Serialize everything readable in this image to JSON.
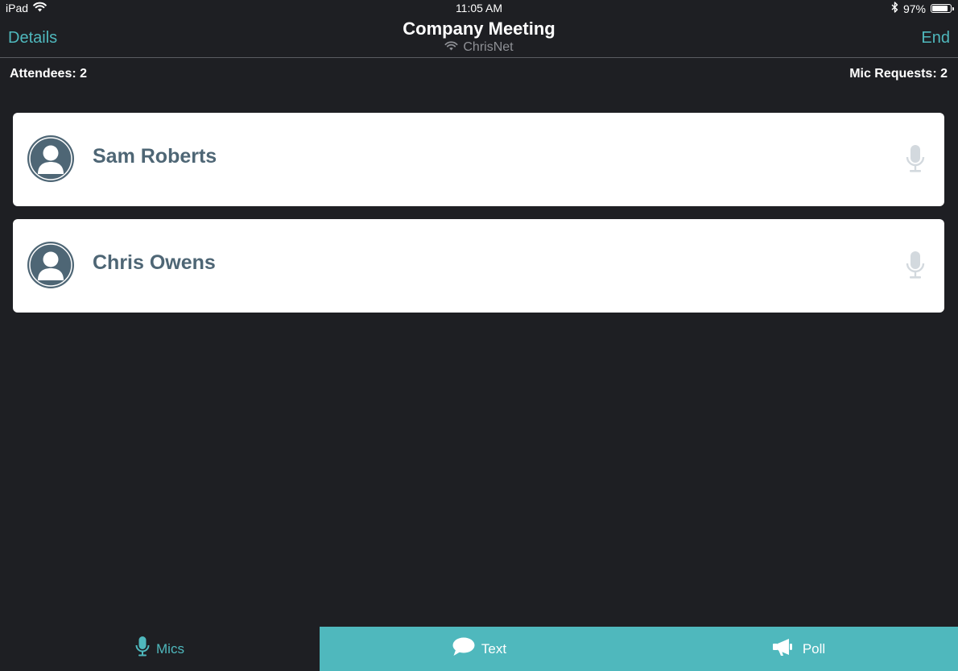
{
  "status_bar": {
    "device": "iPad",
    "time": "11:05 AM",
    "battery_text": "97%",
    "battery_level": 0.97,
    "wifi_icon": "wifi-icon",
    "bluetooth_icon": "bluetooth-icon"
  },
  "nav": {
    "left_label": "Details",
    "title": "Company Meeting",
    "network_name": "ChrisNet",
    "right_label": "End"
  },
  "counters": {
    "attendees": "Attendees: 2",
    "mic_requests": "Mic Requests: 2"
  },
  "attendees": [
    {
      "name": "Sam Roberts",
      "avatar_icon": "person-icon",
      "mic_icon": "microphone-icon"
    },
    {
      "name": "Chris Owens",
      "avatar_icon": "person-icon",
      "mic_icon": "microphone-icon"
    }
  ],
  "tabs": [
    {
      "label": "Mics",
      "icon": "microphone-icon",
      "selected": true
    },
    {
      "label": "Text",
      "icon": "chat-bubble-icon",
      "selected": false
    },
    {
      "label": "Poll",
      "icon": "megaphone-icon",
      "selected": false
    }
  ],
  "colors": {
    "background": "#1e1f23",
    "accent": "#4fb8bd",
    "card": "#ffffff",
    "name_text": "#4e6675",
    "avatar": "#4e6675",
    "mic_inactive": "#d3d9de",
    "subtitle": "#8e9095"
  }
}
